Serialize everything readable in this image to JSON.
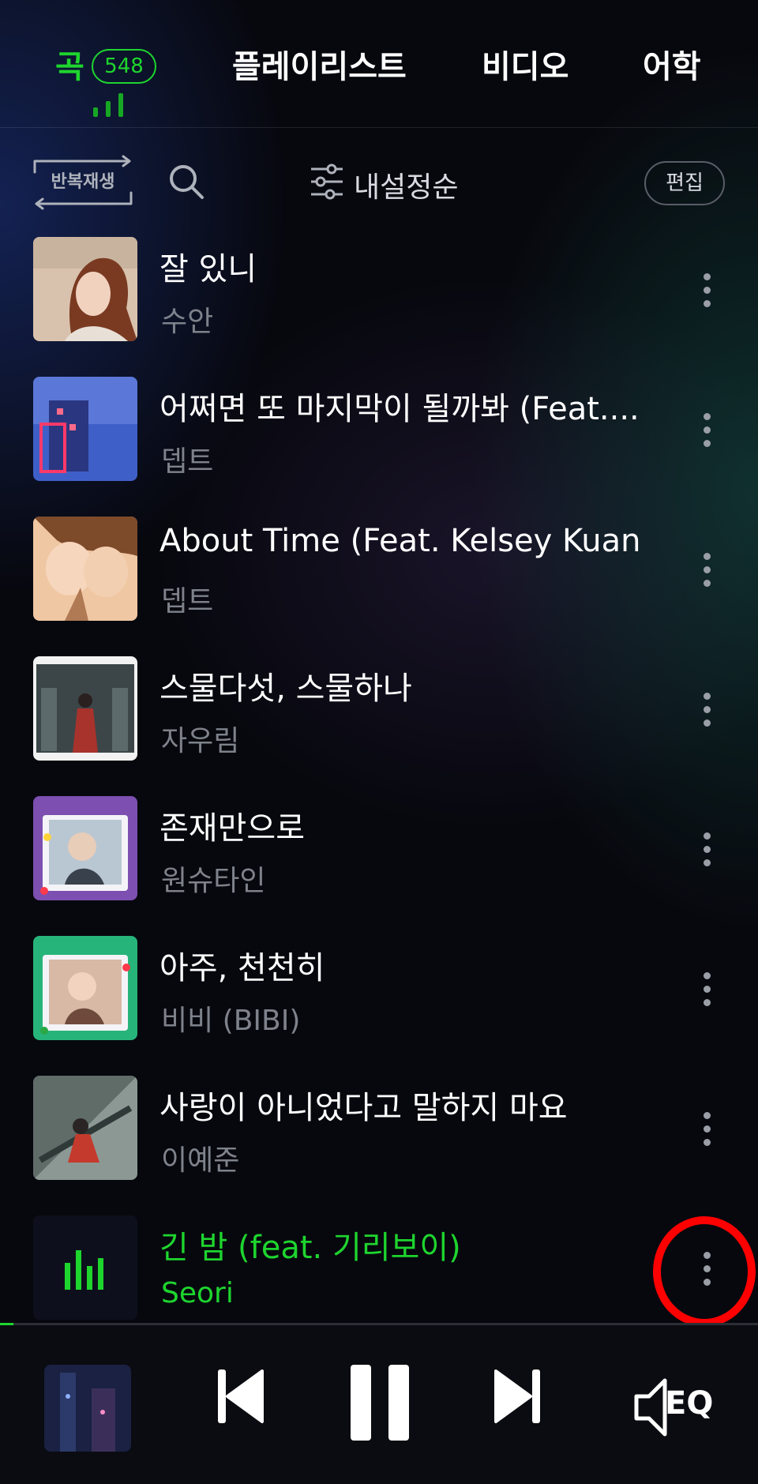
{
  "tabs": [
    {
      "label": "곡",
      "count": "548",
      "active": true
    },
    {
      "label": "플레이리스트"
    },
    {
      "label": "비디오"
    },
    {
      "label": "어학"
    }
  ],
  "toolbar": {
    "repeat_label": "반복재생",
    "sort_label": "내설정순",
    "edit_label": "편집"
  },
  "songs": [
    {
      "title": "잘 있니",
      "artist": "수안"
    },
    {
      "title": "어쩌면 또 마지막이 될까봐 (Feat....",
      "artist": "뎁트"
    },
    {
      "title": "About Time (Feat. Kelsey Kuan)",
      "artist": "뎁트"
    },
    {
      "title": "스물다섯, 스물하나",
      "artist": "자우림"
    },
    {
      "title": "존재만으로",
      "artist": "원슈타인"
    },
    {
      "title": "아주, 천천히",
      "artist": "비비 (BIBI)"
    },
    {
      "title": "사랑이 아니었다고 말하지 마요",
      "artist": "이예준"
    },
    {
      "title": "긴 밤 (feat. 기리보이)",
      "artist": "Seori",
      "playing": true
    }
  ],
  "player": {
    "progress_fraction": 0.018,
    "eq_label": "EQ"
  },
  "colors": {
    "accent": "#1ed52e",
    "annotation": "#ff0000"
  }
}
